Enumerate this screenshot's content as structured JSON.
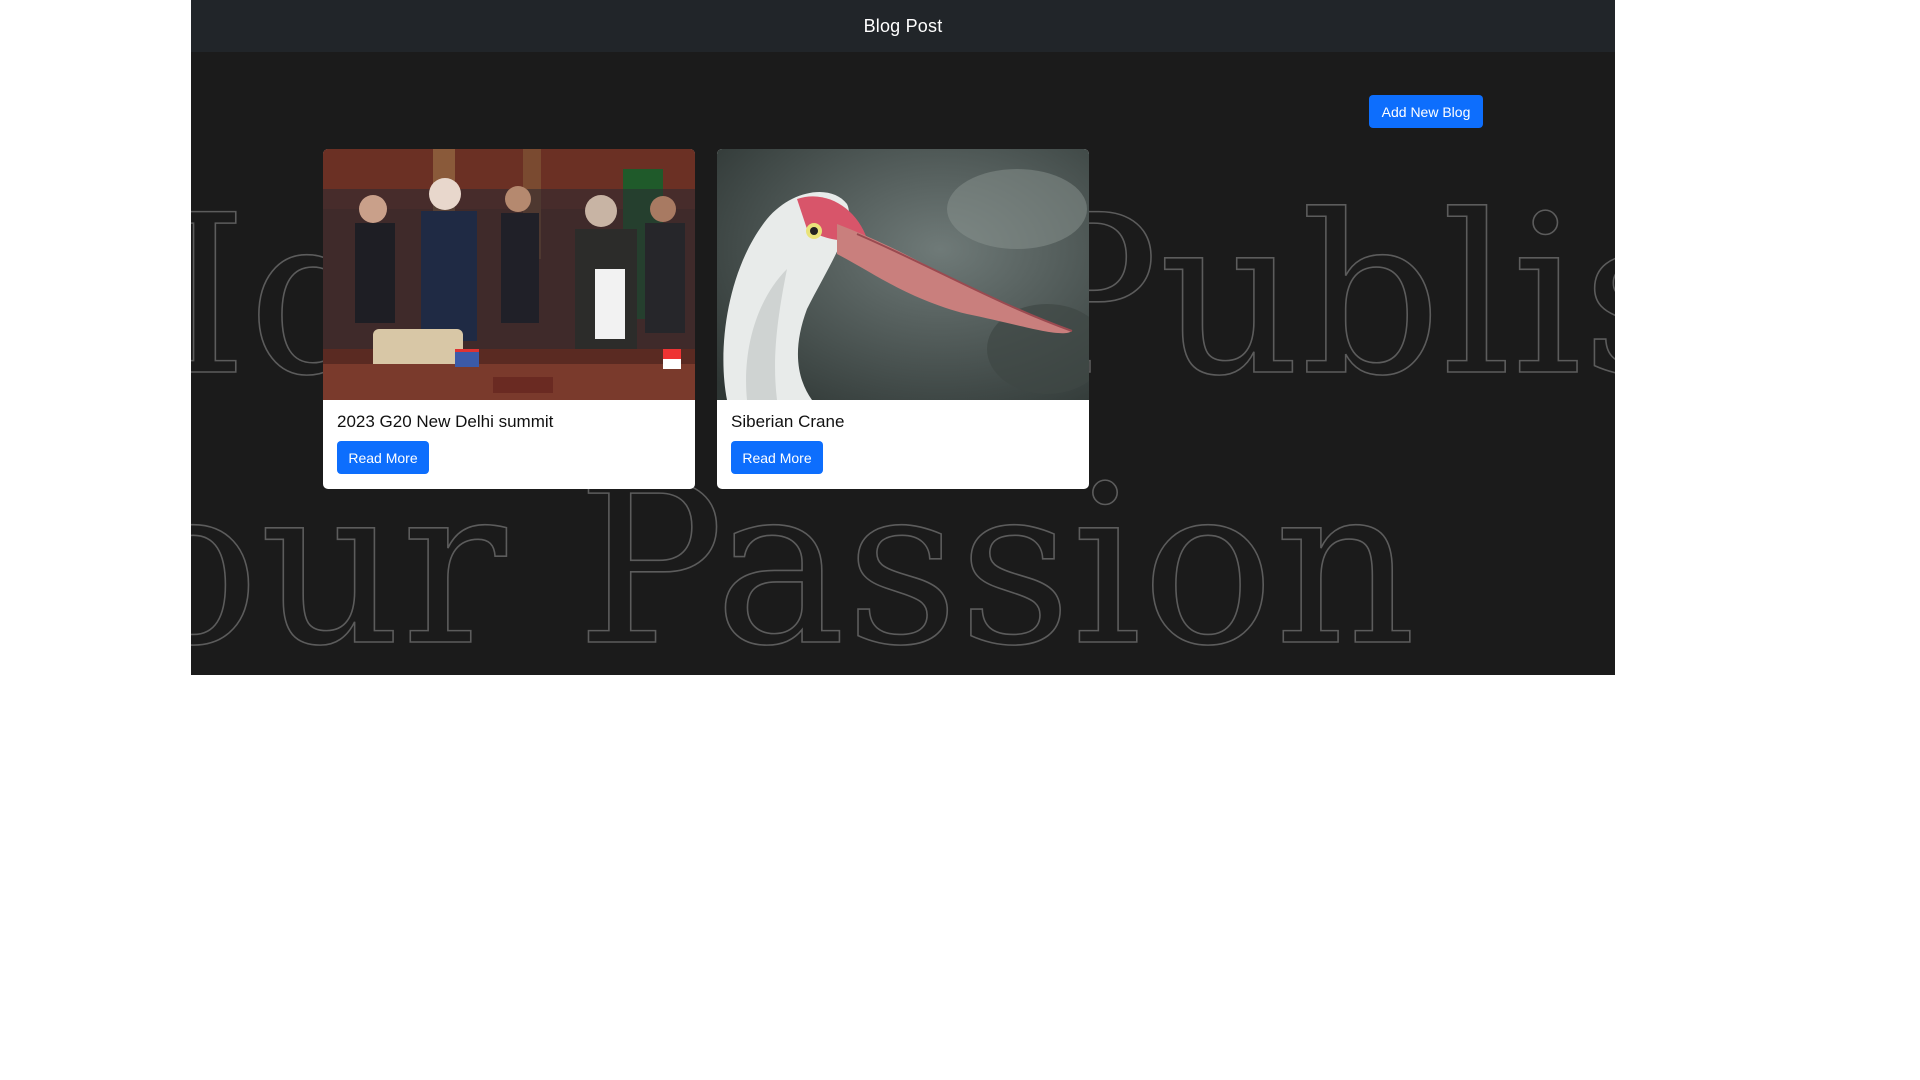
{
  "navbar": {
    "brand": "Blog Post"
  },
  "background_text": {
    "line1": "Idea to Publish",
    "line2": "Your Passion"
  },
  "actions": {
    "add_new_blog": "Add New Blog"
  },
  "cards": [
    {
      "title": "2023 G20 New Delhi summit",
      "button": "Read More"
    },
    {
      "title": "Siberian Crane",
      "button": "Read More"
    }
  ],
  "colors": {
    "page_bg": "#1b1b1b",
    "navbar_bg": "#212529",
    "primary": "#0d6efd",
    "card_bg": "#ffffff"
  }
}
